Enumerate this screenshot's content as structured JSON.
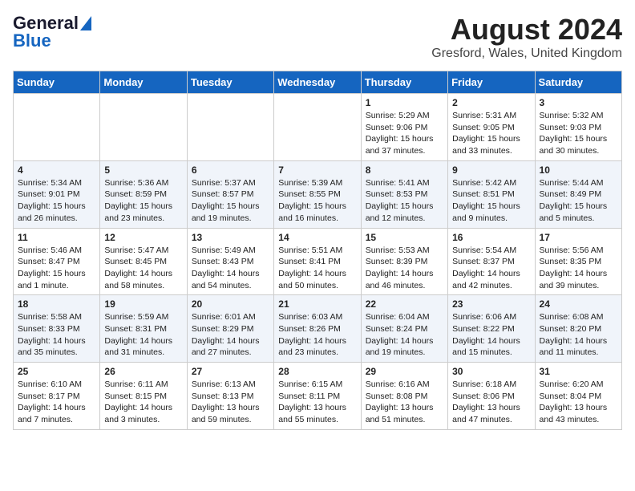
{
  "header": {
    "logo_general": "General",
    "logo_blue": "Blue",
    "title": "August 2024",
    "subtitle": "Gresford, Wales, United Kingdom"
  },
  "days_of_week": [
    "Sunday",
    "Monday",
    "Tuesday",
    "Wednesday",
    "Thursday",
    "Friday",
    "Saturday"
  ],
  "weeks": [
    [
      {
        "day": "",
        "sunrise": "",
        "sunset": "",
        "daylight": ""
      },
      {
        "day": "",
        "sunrise": "",
        "sunset": "",
        "daylight": ""
      },
      {
        "day": "",
        "sunrise": "",
        "sunset": "",
        "daylight": ""
      },
      {
        "day": "",
        "sunrise": "",
        "sunset": "",
        "daylight": ""
      },
      {
        "day": "1",
        "sunrise": "5:29 AM",
        "sunset": "9:06 PM",
        "daylight": "15 hours and 37 minutes."
      },
      {
        "day": "2",
        "sunrise": "5:31 AM",
        "sunset": "9:05 PM",
        "daylight": "15 hours and 33 minutes."
      },
      {
        "day": "3",
        "sunrise": "5:32 AM",
        "sunset": "9:03 PM",
        "daylight": "15 hours and 30 minutes."
      }
    ],
    [
      {
        "day": "4",
        "sunrise": "5:34 AM",
        "sunset": "9:01 PM",
        "daylight": "15 hours and 26 minutes."
      },
      {
        "day": "5",
        "sunrise": "5:36 AM",
        "sunset": "8:59 PM",
        "daylight": "15 hours and 23 minutes."
      },
      {
        "day": "6",
        "sunrise": "5:37 AM",
        "sunset": "8:57 PM",
        "daylight": "15 hours and 19 minutes."
      },
      {
        "day": "7",
        "sunrise": "5:39 AM",
        "sunset": "8:55 PM",
        "daylight": "15 hours and 16 minutes."
      },
      {
        "day": "8",
        "sunrise": "5:41 AM",
        "sunset": "8:53 PM",
        "daylight": "15 hours and 12 minutes."
      },
      {
        "day": "9",
        "sunrise": "5:42 AM",
        "sunset": "8:51 PM",
        "daylight": "15 hours and 9 minutes."
      },
      {
        "day": "10",
        "sunrise": "5:44 AM",
        "sunset": "8:49 PM",
        "daylight": "15 hours and 5 minutes."
      }
    ],
    [
      {
        "day": "11",
        "sunrise": "5:46 AM",
        "sunset": "8:47 PM",
        "daylight": "15 hours and 1 minute."
      },
      {
        "day": "12",
        "sunrise": "5:47 AM",
        "sunset": "8:45 PM",
        "daylight": "14 hours and 58 minutes."
      },
      {
        "day": "13",
        "sunrise": "5:49 AM",
        "sunset": "8:43 PM",
        "daylight": "14 hours and 54 minutes."
      },
      {
        "day": "14",
        "sunrise": "5:51 AM",
        "sunset": "8:41 PM",
        "daylight": "14 hours and 50 minutes."
      },
      {
        "day": "15",
        "sunrise": "5:53 AM",
        "sunset": "8:39 PM",
        "daylight": "14 hours and 46 minutes."
      },
      {
        "day": "16",
        "sunrise": "5:54 AM",
        "sunset": "8:37 PM",
        "daylight": "14 hours and 42 minutes."
      },
      {
        "day": "17",
        "sunrise": "5:56 AM",
        "sunset": "8:35 PM",
        "daylight": "14 hours and 39 minutes."
      }
    ],
    [
      {
        "day": "18",
        "sunrise": "5:58 AM",
        "sunset": "8:33 PM",
        "daylight": "14 hours and 35 minutes."
      },
      {
        "day": "19",
        "sunrise": "5:59 AM",
        "sunset": "8:31 PM",
        "daylight": "14 hours and 31 minutes."
      },
      {
        "day": "20",
        "sunrise": "6:01 AM",
        "sunset": "8:29 PM",
        "daylight": "14 hours and 27 minutes."
      },
      {
        "day": "21",
        "sunrise": "6:03 AM",
        "sunset": "8:26 PM",
        "daylight": "14 hours and 23 minutes."
      },
      {
        "day": "22",
        "sunrise": "6:04 AM",
        "sunset": "8:24 PM",
        "daylight": "14 hours and 19 minutes."
      },
      {
        "day": "23",
        "sunrise": "6:06 AM",
        "sunset": "8:22 PM",
        "daylight": "14 hours and 15 minutes."
      },
      {
        "day": "24",
        "sunrise": "6:08 AM",
        "sunset": "8:20 PM",
        "daylight": "14 hours and 11 minutes."
      }
    ],
    [
      {
        "day": "25",
        "sunrise": "6:10 AM",
        "sunset": "8:17 PM",
        "daylight": "14 hours and 7 minutes."
      },
      {
        "day": "26",
        "sunrise": "6:11 AM",
        "sunset": "8:15 PM",
        "daylight": "14 hours and 3 minutes."
      },
      {
        "day": "27",
        "sunrise": "6:13 AM",
        "sunset": "8:13 PM",
        "daylight": "13 hours and 59 minutes."
      },
      {
        "day": "28",
        "sunrise": "6:15 AM",
        "sunset": "8:11 PM",
        "daylight": "13 hours and 55 minutes."
      },
      {
        "day": "29",
        "sunrise": "6:16 AM",
        "sunset": "8:08 PM",
        "daylight": "13 hours and 51 minutes."
      },
      {
        "day": "30",
        "sunrise": "6:18 AM",
        "sunset": "8:06 PM",
        "daylight": "13 hours and 47 minutes."
      },
      {
        "day": "31",
        "sunrise": "6:20 AM",
        "sunset": "8:04 PM",
        "daylight": "13 hours and 43 minutes."
      }
    ]
  ]
}
